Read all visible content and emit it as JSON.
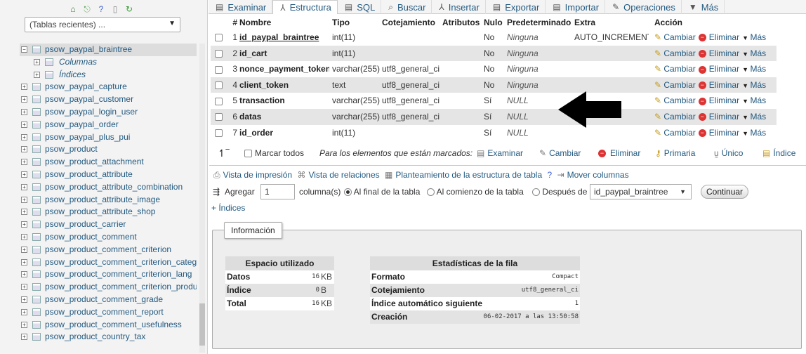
{
  "nav": {
    "recent_select": "(Tablas recientes) ...",
    "tree": [
      {
        "label": "psow_paypal_braintree",
        "type": "table",
        "expanded": true,
        "selected": true
      },
      {
        "label": "Columnas",
        "type": "sub"
      },
      {
        "label": "Índices",
        "type": "sub"
      },
      {
        "label": "psow_paypal_capture",
        "type": "table"
      },
      {
        "label": "psow_paypal_customer",
        "type": "table"
      },
      {
        "label": "psow_paypal_login_user",
        "type": "table"
      },
      {
        "label": "psow_paypal_order",
        "type": "table"
      },
      {
        "label": "psow_paypal_plus_pui",
        "type": "table"
      },
      {
        "label": "psow_product",
        "type": "table"
      },
      {
        "label": "psow_product_attachment",
        "type": "table"
      },
      {
        "label": "psow_product_attribute",
        "type": "table"
      },
      {
        "label": "psow_product_attribute_combination",
        "type": "table"
      },
      {
        "label": "psow_product_attribute_image",
        "type": "table"
      },
      {
        "label": "psow_product_attribute_shop",
        "type": "table"
      },
      {
        "label": "psow_product_carrier",
        "type": "table"
      },
      {
        "label": "psow_product_comment",
        "type": "table"
      },
      {
        "label": "psow_product_comment_criterion",
        "type": "table"
      },
      {
        "label": "psow_product_comment_criterion_catego",
        "type": "table"
      },
      {
        "label": "psow_product_comment_criterion_lang",
        "type": "table"
      },
      {
        "label": "psow_product_comment_criterion_produc",
        "type": "table"
      },
      {
        "label": "psow_product_comment_grade",
        "type": "table"
      },
      {
        "label": "psow_product_comment_report",
        "type": "table"
      },
      {
        "label": "psow_product_comment_usefulness",
        "type": "table"
      },
      {
        "label": "psow_product_country_tax",
        "type": "table"
      }
    ]
  },
  "tabs": [
    {
      "label": "Examinar",
      "icon": "browse-icon",
      "glyph": "▤",
      "active": false
    },
    {
      "label": "Estructura",
      "icon": "structure-icon",
      "glyph": "⅄",
      "active": true
    },
    {
      "label": "SQL",
      "icon": "sql-icon",
      "glyph": "▤",
      "active": false
    },
    {
      "label": "Buscar",
      "icon": "search-icon",
      "glyph": "⌕",
      "active": false
    },
    {
      "label": "Insertar",
      "icon": "insert-icon",
      "glyph": "⅄",
      "active": false
    },
    {
      "label": "Exportar",
      "icon": "export-icon",
      "glyph": "▤",
      "active": false
    },
    {
      "label": "Importar",
      "icon": "import-icon",
      "glyph": "▤",
      "active": false
    },
    {
      "label": "Operaciones",
      "icon": "wrench-icon",
      "glyph": "✎",
      "active": false
    },
    {
      "label": "Más",
      "icon": "more-caret-icon",
      "glyph": "▼",
      "active": false
    }
  ],
  "columns": {
    "num": "#",
    "name": "Nombre",
    "type": "Tipo",
    "collation": "Cotejamiento",
    "attributes": "Atributos",
    "null": "Nulo",
    "default": "Predeterminado",
    "extra": "Extra",
    "action": "Acción"
  },
  "rows": [
    {
      "num": "1",
      "name": "id_paypal_braintree",
      "type": "int(11)",
      "collation": "",
      "null": "No",
      "default": "Ninguna",
      "extra": "AUTO_INCREMENT"
    },
    {
      "num": "2",
      "name": "id_cart",
      "type": "int(11)",
      "collation": "",
      "null": "No",
      "default": "Ninguna",
      "extra": ""
    },
    {
      "num": "3",
      "name": "nonce_payment_token",
      "type": "varchar(255)",
      "collation": "utf8_general_ci",
      "null": "No",
      "default": "Ninguna",
      "extra": ""
    },
    {
      "num": "4",
      "name": "client_token",
      "type": "text",
      "collation": "utf8_general_ci",
      "null": "No",
      "default": "Ninguna",
      "extra": ""
    },
    {
      "num": "5",
      "name": "transaction",
      "type": "varchar(255)",
      "collation": "utf8_general_ci",
      "null": "Sí",
      "default": "NULL",
      "extra": ""
    },
    {
      "num": "6",
      "name": "datas",
      "type": "varchar(255)",
      "collation": "utf8_general_ci",
      "null": "Sí",
      "default": "NULL",
      "extra": ""
    },
    {
      "num": "7",
      "name": "id_order",
      "type": "int(11)",
      "collation": "",
      "null": "Sí",
      "default": "NULL",
      "extra": ""
    }
  ],
  "row_actions": {
    "change": "Cambiar",
    "drop": "Eliminar",
    "more": "Más"
  },
  "bulk": {
    "check_all": "Marcar todos",
    "with_selected": "Para los elementos que están marcados:",
    "browse": "Examinar",
    "change": "Cambiar",
    "drop": "Eliminar",
    "primary": "Primaria",
    "unique": "Único",
    "index": "Índice"
  },
  "links": {
    "print": "Vista de impresión",
    "relation": "Vista de relaciones",
    "propose": "Planteamiento de la estructura de tabla",
    "move": "Mover columnas"
  },
  "add": {
    "label": "Agregar",
    "count": "1",
    "unit": "columna(s)",
    "at_end": "Al final de la tabla",
    "at_start": "Al comienzo de la tabla",
    "after": "Después de",
    "after_column": "id_paypal_braintree",
    "submit": "Continuar"
  },
  "indexes_link": "+ Índices",
  "info": {
    "legend": "Información",
    "space": {
      "title": "Espacio utilizado",
      "rows": [
        {
          "key": "Datos",
          "value": "16",
          "unit": "KB"
        },
        {
          "key": "Índice",
          "value": "0",
          "unit": "B"
        },
        {
          "key": "Total",
          "value": "16",
          "unit": "KB"
        }
      ]
    },
    "stats": {
      "title": "Estadísticas de la fila",
      "rows": [
        {
          "key": "Formato",
          "value": "Compact"
        },
        {
          "key": "Cotejamiento",
          "value": "utf8_general_ci"
        },
        {
          "key": "Índice automático siguiente",
          "value": "1"
        },
        {
          "key": "Creación",
          "value": "06-02-2017 a las 13:50:58"
        }
      ]
    }
  },
  "colors": {
    "link": "#235a81",
    "alt_row": "#e5e5e5",
    "drop": "#d33333"
  }
}
